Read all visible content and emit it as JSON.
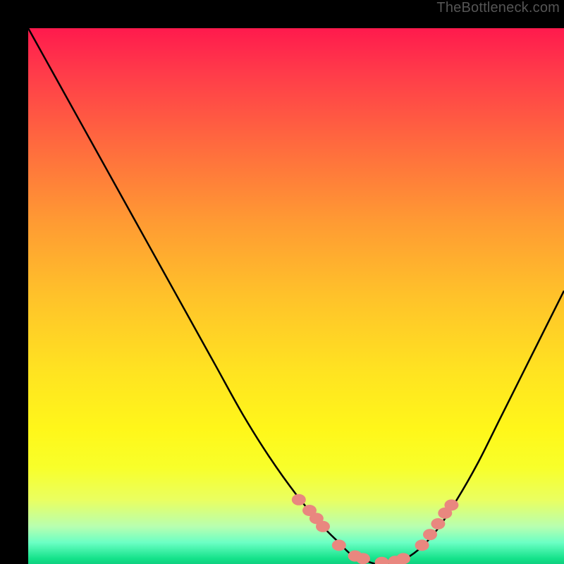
{
  "watermark": "TheBottleneck.com",
  "colors": {
    "curve_stroke": "#000000",
    "marker_fill": "#e9877f",
    "marker_stroke": "#e9877f"
  },
  "chart_data": {
    "type": "line",
    "title": "",
    "xlabel": "",
    "ylabel": "",
    "xlim": [
      0,
      100
    ],
    "ylim": [
      0,
      100
    ],
    "series": [
      {
        "name": "bottleneck-curve",
        "x": [
          0,
          5,
          10,
          15,
          20,
          25,
          30,
          35,
          40,
          45,
          50,
          55,
          58,
          60,
          62,
          65,
          68,
          72,
          76,
          80,
          84,
          88,
          92,
          96,
          100
        ],
        "y": [
          100,
          91,
          82,
          73,
          64,
          55,
          46,
          37,
          28,
          20,
          13,
          7,
          4,
          2,
          1,
          0,
          0,
          2,
          6,
          12,
          19,
          27,
          35,
          43,
          51
        ]
      }
    ],
    "markers": {
      "name": "highlight-points",
      "x": [
        50.5,
        52.5,
        53.8,
        55.0,
        58.0,
        61.0,
        62.5,
        66.0,
        68.5,
        70.0,
        73.5,
        75.0,
        76.5,
        77.8,
        79.0
      ],
      "y": [
        12.0,
        10.0,
        8.5,
        7.0,
        3.5,
        1.5,
        1.0,
        0.3,
        0.5,
        1.0,
        3.5,
        5.5,
        7.5,
        9.5,
        11.0
      ]
    }
  }
}
